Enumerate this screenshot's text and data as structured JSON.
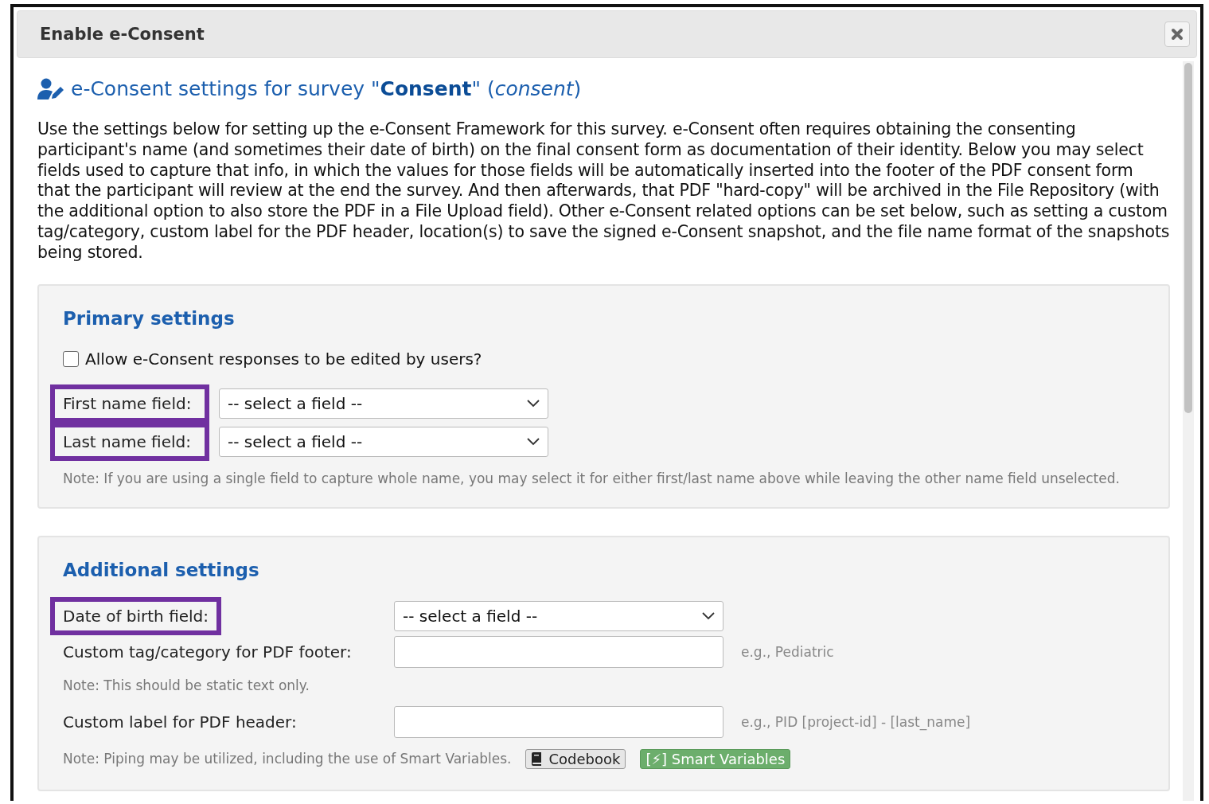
{
  "dialog": {
    "title": "Enable e-Consent"
  },
  "heading": "e-Consent settings for survey \"**Consent**\" (*consent*)",
  "intro": "Use the settings below for setting up the e-Consent Framework for this survey. e-Consent often requires obtaining the consenting participant's name (and sometimes their date of birth) on the final consent form as documentation of their identity. Below you may select fields used to capture that info, in which the values for those fields will be automatically inserted into the footer of the PDF consent form that the participant will review at the end the survey. And then afterwards, that PDF \"hard-copy\" will be archived in the File Repository (with the additional option to also store the PDF in a File Upload field). Other e-Consent related options can be set below, such as setting a custom tag/category, custom label for the PDF header, location(s) to save the signed e-Consent snapshot, and the file name format of the snapshots being stored.",
  "primary_settings": {
    "title": "Primary settings",
    "checkbox": {
      "label": "Allow e-Consent responses to be edited by users?",
      "checked": false
    },
    "fields": [
      {
        "label": "First name field:",
        "highlighted": true,
        "kind": "select",
        "value": "-- select a field --"
      },
      {
        "label": "Last name field:",
        "highlighted": true,
        "kind": "select",
        "value": "-- select a field --"
      }
    ],
    "note": "Note: If you are using a single field to capture whole name, you may select it for either first/last name above while leaving the other name field unselected."
  },
  "additional_settings": {
    "title": "Additional settings",
    "fields": [
      {
        "label": "Date of birth field:",
        "highlighted": true,
        "kind": "select",
        "value": "-- select a field --"
      },
      {
        "label": "Custom tag/category for PDF footer:",
        "highlighted": false,
        "kind": "text",
        "example": "e.g., Pediatric",
        "note": "Note: This should be static text only."
      },
      {
        "label": "Custom label for PDF header:",
        "highlighted": false,
        "kind": "text",
        "example": "e.g., PID [project-id] - [last_name]"
      }
    ],
    "piping_note": "Note: Piping may be utilized, including the use of Smart Variables.",
    "buttons": [
      {
        "label": "Codebook",
        "kind": "codebook"
      },
      {
        "label": "[⚡] Smart Variables",
        "kind": "smart"
      }
    ]
  }
}
